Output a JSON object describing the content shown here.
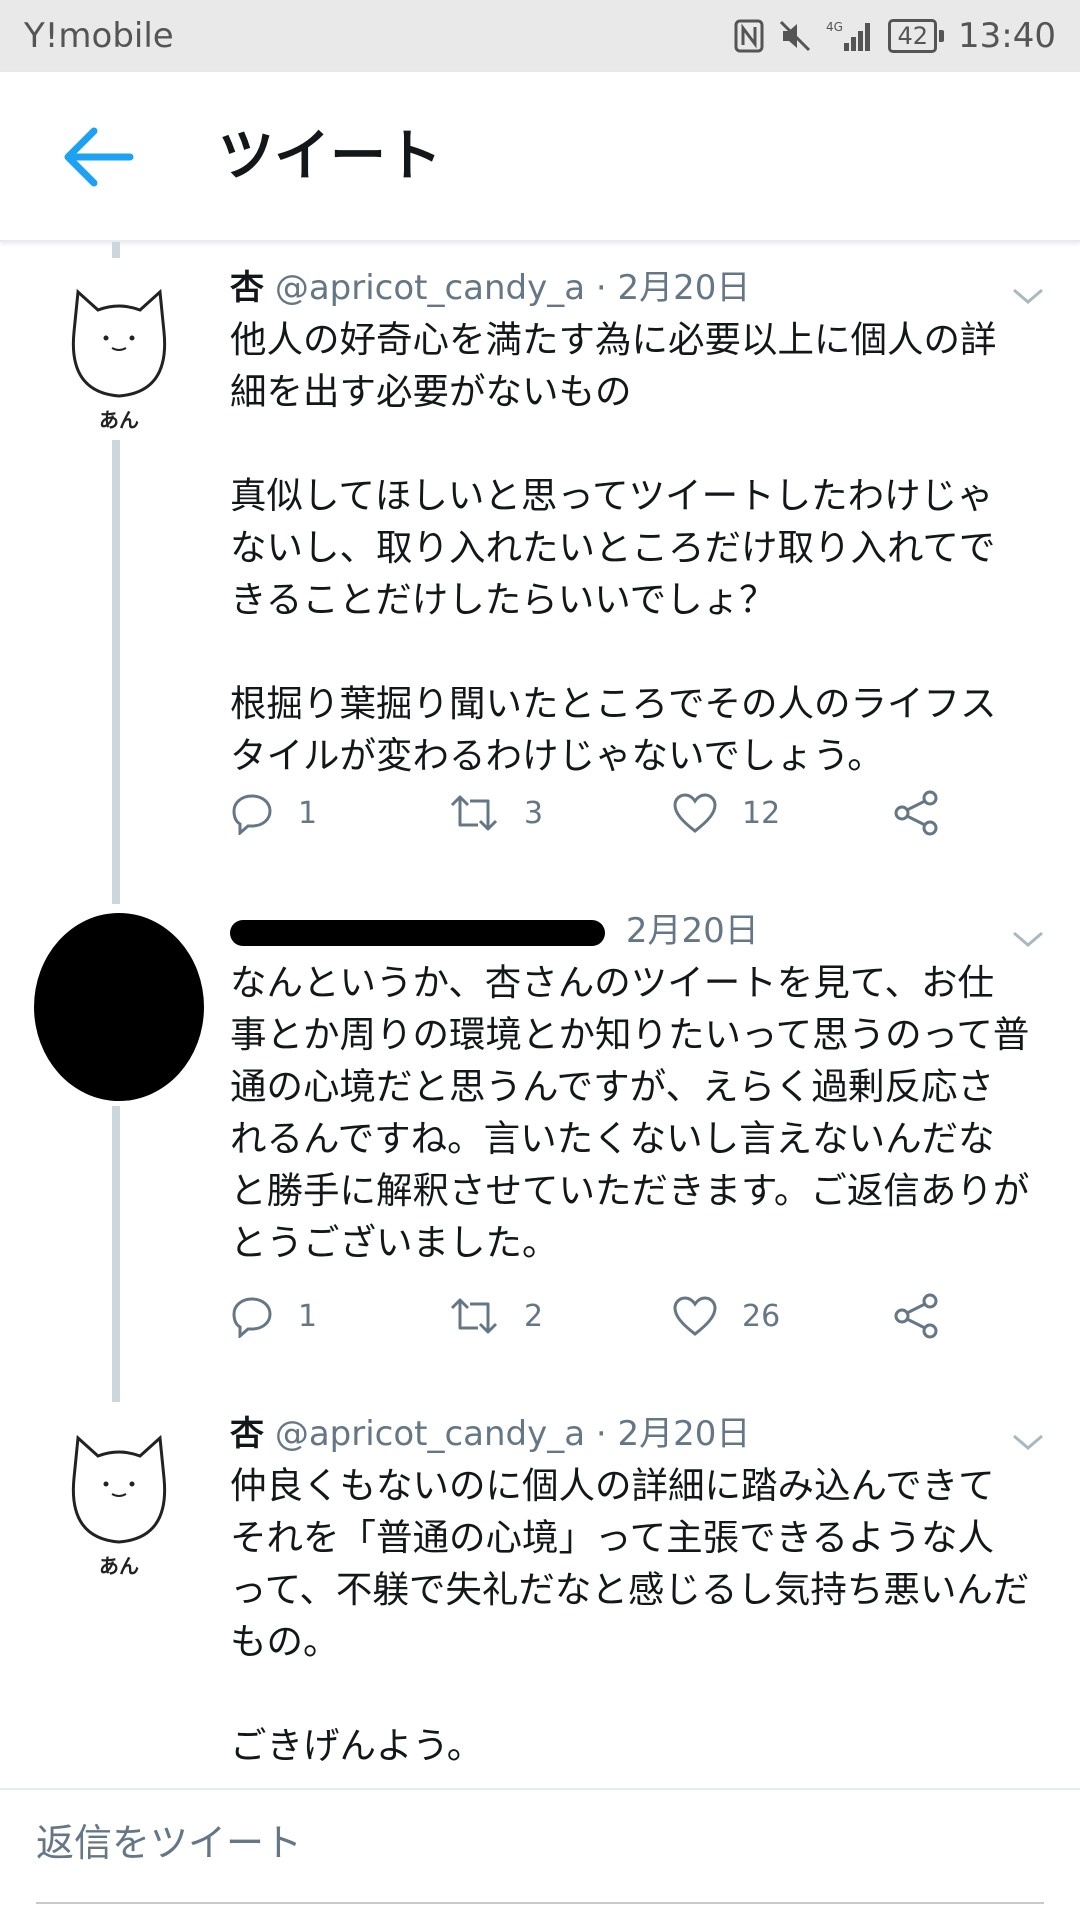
{
  "status_bar": {
    "carrier": "Y!mobile",
    "network": "4G",
    "battery": "42",
    "time": "13:40"
  },
  "header": {
    "title": "ツイート",
    "back_icon": "arrow-left-icon",
    "accent": "#1da1f2"
  },
  "tweets": [
    {
      "name": "杏",
      "handle": "@apricot_candy_a",
      "date": "· 2月20日",
      "avatar_label": "あん",
      "text": "他人の好奇心を満たす為に必要以上に個人の詳細を出す必要がないもの\n\n真似してほしいと思ってツイートしたわけじゃないし、取り入れたいところだけ取り入れてできることだけしたらいいでしょ？\n\n根掘り葉掘り聞いたところでその人のライフスタイルが変わるわけじゃないでしょう。",
      "replies": "1",
      "retweets": "3",
      "likes": "12"
    },
    {
      "name": "",
      "handle": "",
      "date": "2月20日",
      "text": "なんというか、杏さんのツイートを見て、お仕事とか周りの環境とか知りたいって思うのって普通の心境だと思うんですが、えらく過剰反応されるんですね。言いたくないし言えないんだなと勝手に解釈させていただきます。ご返信ありがとうございました。",
      "replies": "1",
      "retweets": "2",
      "likes": "26"
    },
    {
      "name": "杏",
      "handle": "@apricot_candy_a",
      "date": "· 2月20日",
      "avatar_label": "あん",
      "text": "仲良くもないのに個人の詳細に踏み込んできてそれを「普通の心境」って主張できるような人って、不躾で失礼だなと感じるし気持ち悪いんだもの。\n\nごきげんよう。"
    }
  ],
  "reply_bar": {
    "placeholder": "返信をツイート"
  }
}
